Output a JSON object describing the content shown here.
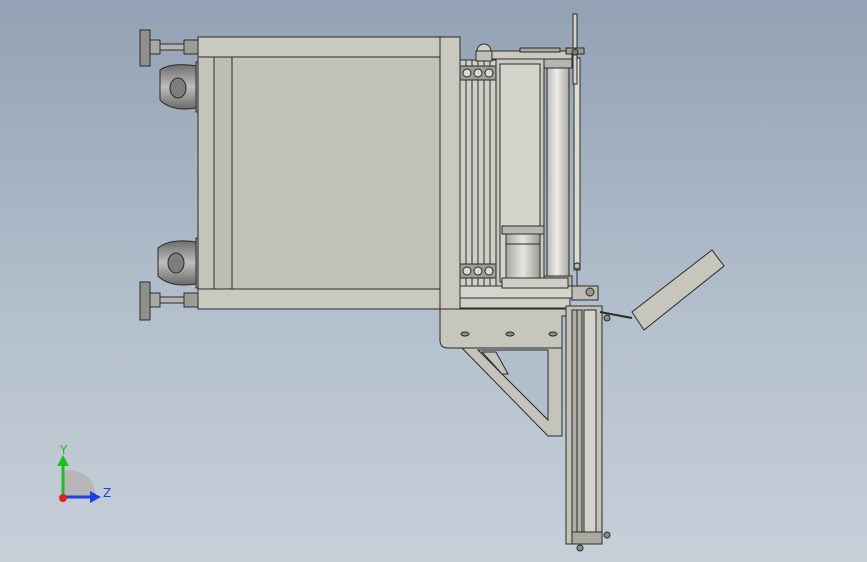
{
  "triad": {
    "y_label": "Y",
    "z_label": "Z",
    "colors": {
      "y_axis": "#1fbf1f",
      "z_axis": "#1f3fe0",
      "x_axis": "#e01f1f"
    }
  },
  "colors": {
    "background_top": "#93a1b4",
    "background_bottom": "#c7d0d9",
    "frame_fill": "#c4c4bb",
    "frame_edge": "#2b2b2b",
    "wheel_fill": "#9a9a98",
    "column_fill": "#d6d6d2",
    "chute_fill": "#b8b8ae"
  }
}
